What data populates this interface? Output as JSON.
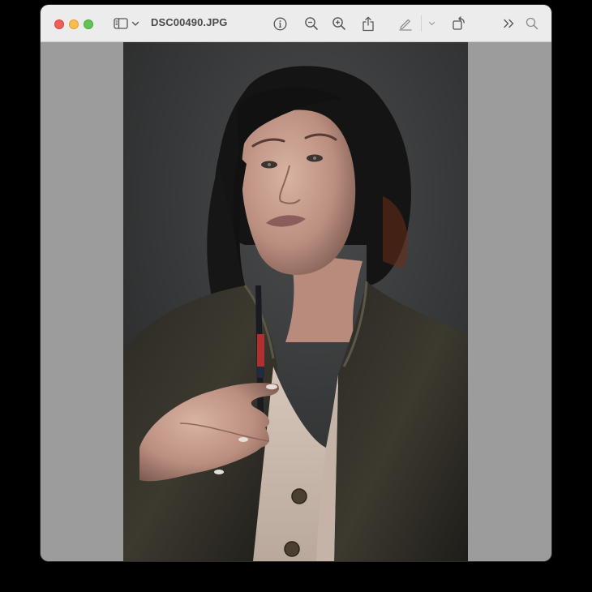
{
  "window": {
    "title": "DSC00490.JPG"
  },
  "toolbar": {
    "icons": [
      "sidebar-toggle-icon",
      "chevron-down-icon",
      "info-icon",
      "zoom-out-icon",
      "zoom-in-icon",
      "share-icon",
      "markup-pen-icon",
      "chevron-down-icon",
      "rotate-icon",
      "more-chevrons-icon",
      "search-icon"
    ]
  },
  "colors": {
    "close": "#ee5f57",
    "minimize": "#f6be4f",
    "zoom": "#61c454",
    "titlebar": "#ececec",
    "canvas": "#9c9c9c",
    "photo_background": "#363839"
  }
}
